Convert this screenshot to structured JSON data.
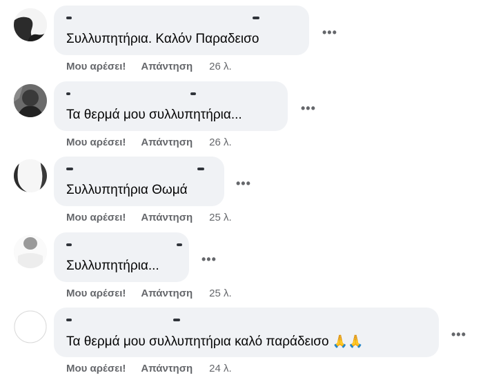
{
  "comments": [
    {
      "text": "Συλλυπητήρια. Καλόν Παραδεισο",
      "like_label": "Μου αρέσει!",
      "reply_label": "Απάντηση",
      "time": "26 λ.",
      "more_label": "•••"
    },
    {
      "text": "Τα θερμά μου συλλυπητήρια...",
      "like_label": "Μου αρέσει!",
      "reply_label": "Απάντηση",
      "time": "26 λ.",
      "more_label": "•••"
    },
    {
      "text": "Συλλυπητήρια Θωμά",
      "like_label": "Μου αρέσει!",
      "reply_label": "Απάντηση",
      "time": "25 λ.",
      "more_label": "•••"
    },
    {
      "text": "Συλλυπητήρια...",
      "like_label": "Μου αρέσει!",
      "reply_label": "Απάντηση",
      "time": "25 λ.",
      "more_label": "•••"
    },
    {
      "text": "Τα θερμά μου συλλυπητήρια καλό παράδεισο",
      "emoji": "🙏🙏",
      "like_label": "Μου αρέσει!",
      "reply_label": "Απάντηση",
      "time": "24 λ.",
      "more_label": "•••"
    }
  ],
  "colors": {
    "bubble_bg": "#f0f2f5",
    "meta_text": "#65676b",
    "body_text": "#050505"
  }
}
